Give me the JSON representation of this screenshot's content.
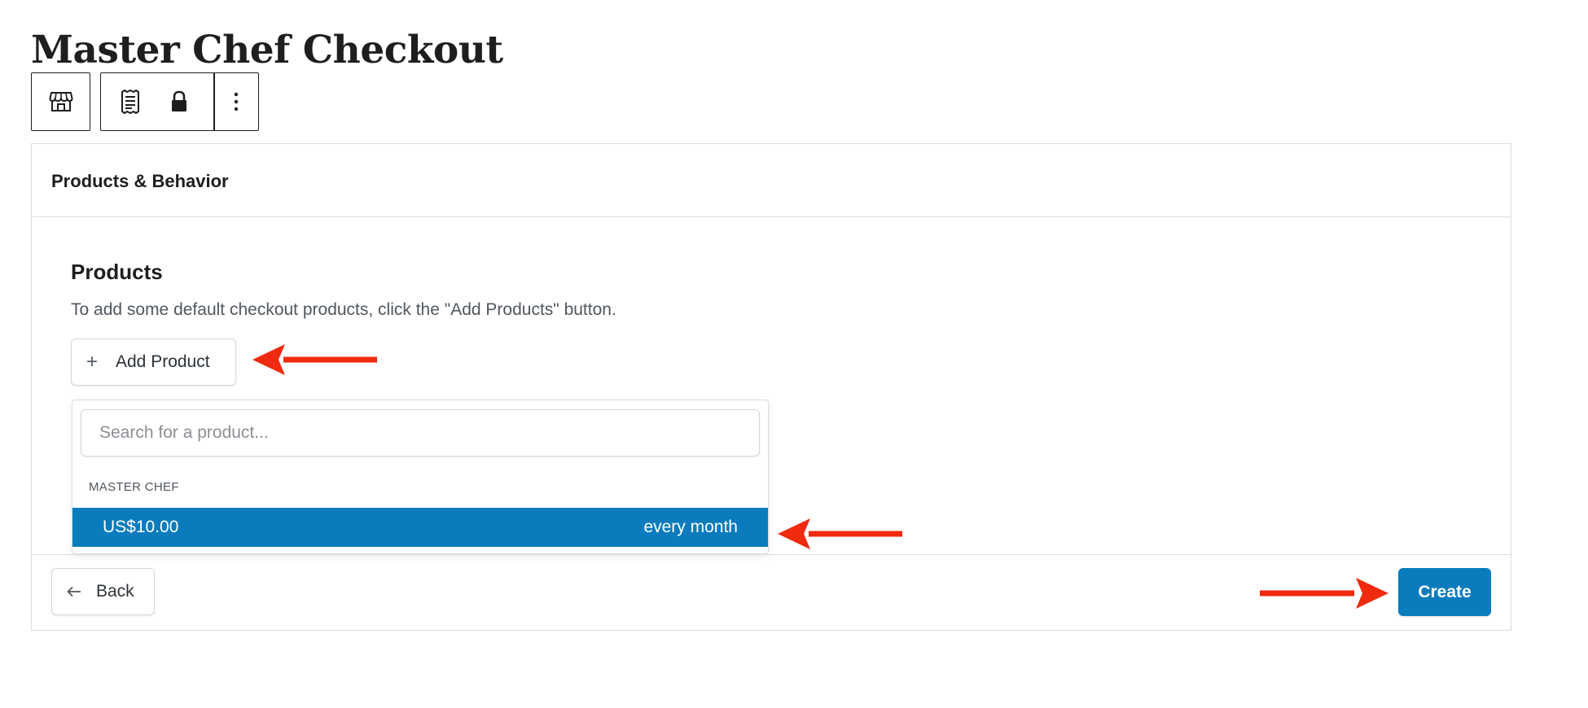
{
  "page": {
    "title": "Master Chef Checkout"
  },
  "toolbar": {
    "icons": [
      "store-icon",
      "receipt-icon",
      "lock-icon",
      "more-vertical-icon"
    ]
  },
  "panel": {
    "header_title": "Products & Behavior",
    "section_title": "Products",
    "section_description": "To add some default checkout products, click the \"Add Products\" button.",
    "add_product_label": "Add Product",
    "dropdown": {
      "search_placeholder": "Search for a product...",
      "search_value": "",
      "group_label": "MASTER CHEF",
      "options": [
        {
          "price": "US$10.00",
          "interval": "every month",
          "selected": true
        }
      ]
    },
    "footer": {
      "back_label": "Back",
      "create_label": "Create"
    }
  },
  "colors": {
    "accent": "#0a7cbd",
    "annotation_arrow": "#f02a0e",
    "border": "#dcdcde",
    "text_primary": "#1e1e1e",
    "text_secondary": "#50575e"
  }
}
